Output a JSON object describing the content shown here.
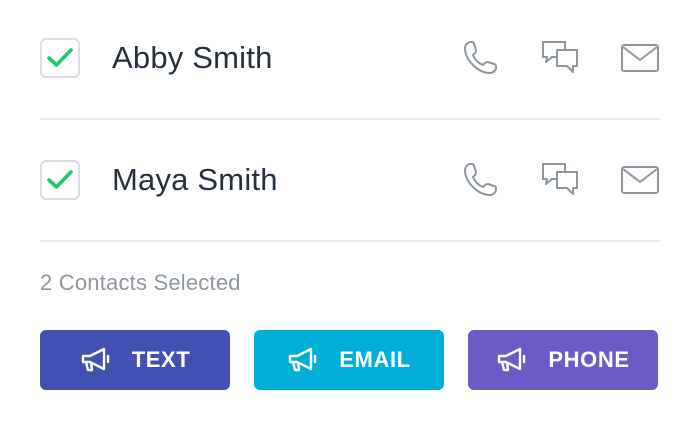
{
  "contacts": [
    {
      "name": "Abby Smith",
      "selected": true
    },
    {
      "name": "Maya Smith",
      "selected": true
    }
  ],
  "icons": {
    "check": "checkmark-icon",
    "phone": "phone-icon",
    "chat": "chat-bubbles-icon",
    "mail": "envelope-icon",
    "megaphone": "megaphone-icon"
  },
  "selection": {
    "summary": "2 Contacts Selected"
  },
  "actions": {
    "text_label": "TEXT",
    "email_label": "EMAIL",
    "phone_label": "PHONE"
  },
  "colors": {
    "check": "#1dc96f",
    "icon_gray": "#8e969f",
    "text_button": "#4350b3",
    "email_button": "#00aed8",
    "phone_button": "#6b5bc6"
  }
}
